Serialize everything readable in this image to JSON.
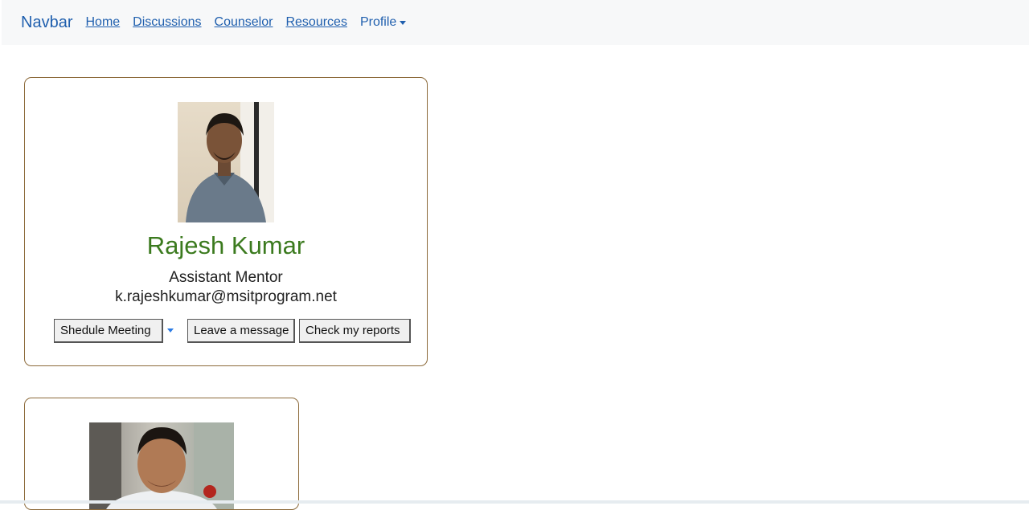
{
  "navbar": {
    "brand": "Navbar",
    "links": [
      "Home",
      "Discussions",
      "Counselor",
      "Resources"
    ],
    "profile_label": "Profile"
  },
  "cards": [
    {
      "name": "Rajesh Kumar",
      "role": "Assistant Mentor",
      "email": "k.rajeshkumar@msitprogram.net",
      "buttons": {
        "schedule": "Shedule Meeting",
        "message": "Leave a message",
        "reports": "Check my reports"
      }
    }
  ],
  "colors": {
    "brand": "#1f5fae",
    "name": "#3b7a1e",
    "card_border": "#8c6a3a"
  }
}
